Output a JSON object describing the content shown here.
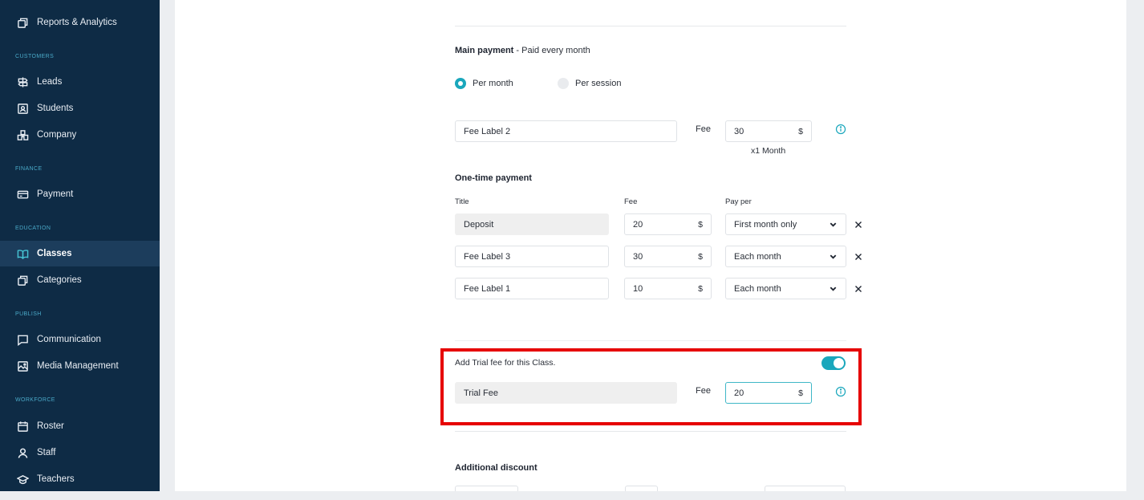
{
  "sidebar": {
    "items": [
      {
        "label": "Reports & Analytics",
        "icon": "copy-icon"
      },
      {
        "label": "Leads",
        "icon": "signpost-icon"
      },
      {
        "label": "Students",
        "icon": "id-badge-icon"
      },
      {
        "label": "Company",
        "icon": "building-icon"
      },
      {
        "label": "Payment",
        "icon": "credit-card-icon"
      },
      {
        "label": "Classes",
        "icon": "book-open-icon"
      },
      {
        "label": "Categories",
        "icon": "copy-icon"
      },
      {
        "label": "Communication",
        "icon": "chat-square-icon"
      },
      {
        "label": "Media Management",
        "icon": "image-icon"
      },
      {
        "label": "Roster",
        "icon": "calendar-icon"
      },
      {
        "label": "Staff",
        "icon": "user-icon"
      },
      {
        "label": "Teachers",
        "icon": "graduation-cap-icon"
      }
    ],
    "sections": {
      "customers": "CUSTOMERS",
      "finance": "FINANCE",
      "education": "EDUCATION",
      "publish": "PUBLISH",
      "workforce": "WORKFORCE"
    },
    "active": "Classes"
  },
  "main_payment": {
    "title": "Main payment",
    "subtitle": "- Paid every month",
    "options": [
      {
        "label": "Per month",
        "selected": true
      },
      {
        "label": "Per session",
        "selected": false
      }
    ],
    "fee_label_value": "Fee Label 2",
    "fee_text": "Fee",
    "fee_value": "30",
    "currency": "$",
    "period": "x1 Month"
  },
  "one_time_payment": {
    "title": "One-time payment",
    "columns": {
      "title": "Title",
      "fee": "Fee",
      "pay_per": "Pay per"
    },
    "rows": [
      {
        "title": "Deposit",
        "fee": "20",
        "currency": "$",
        "pay_per": "First month only"
      },
      {
        "title": "Fee Label 3",
        "fee": "30",
        "currency": "$",
        "pay_per": "Each month"
      },
      {
        "title": "Fee Label 1",
        "fee": "10",
        "currency": "$",
        "pay_per": "Each month"
      }
    ]
  },
  "trial": {
    "toggle_label": "Add Trial fee for this Class.",
    "enabled": true,
    "label_value": "Trial Fee",
    "fee_text": "Fee",
    "fee_value": "20",
    "currency": "$"
  },
  "additional_discount": {
    "title": "Additional discount"
  },
  "colors": {
    "sidebar_bg": "#0e2b45",
    "accent": "#1aa7bc",
    "highlight": "#e60000"
  }
}
